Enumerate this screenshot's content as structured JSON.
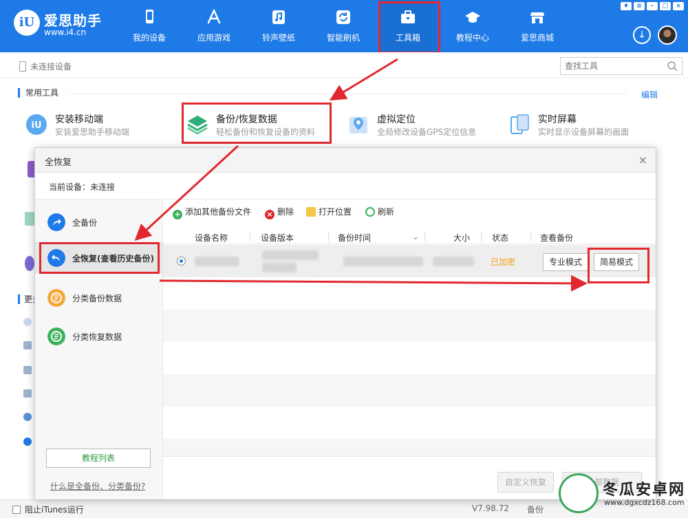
{
  "brand": {
    "logo_text": "iU",
    "name": "爱思助手",
    "url": "www.i4.cn"
  },
  "nav": [
    {
      "label": "我的设备",
      "icon": "phone-icon"
    },
    {
      "label": "应用游戏",
      "icon": "app-store-icon"
    },
    {
      "label": "铃声壁纸",
      "icon": "music-icon"
    },
    {
      "label": "智能刷机",
      "icon": "refresh-icon"
    },
    {
      "label": "工具箱",
      "icon": "toolbox-icon",
      "active": true
    },
    {
      "label": "教程中心",
      "icon": "graduation-cap-icon"
    },
    {
      "label": "爱思商城",
      "icon": "store-icon"
    }
  ],
  "device_bar": {
    "status": "未连接设备",
    "search_placeholder": "查找工具"
  },
  "common_tools": {
    "title": "常用工具",
    "edit": "编辑",
    "items": [
      {
        "name": "安装移动端",
        "desc": "安装爱思助手移动端",
        "icon": "i4-app-icon"
      },
      {
        "name": "备份/恢复数据",
        "desc": "轻松备份和恢复设备的资料",
        "icon": "layers-icon"
      },
      {
        "name": "虚拟定位",
        "desc": "全局修改设备GPS定位信息",
        "icon": "map-pin-icon"
      },
      {
        "name": "实时屏幕",
        "desc": "实时显示设备屏幕的画面",
        "icon": "screen-icon"
      }
    ]
  },
  "more_tools": {
    "title": "更多"
  },
  "dialog": {
    "title": "全恢复",
    "close": "×",
    "current_device": "当前设备：未连接",
    "sidebar": [
      {
        "label": "全备份",
        "icon": "share-arrow-icon",
        "color": "#1e7ae6"
      },
      {
        "label": "全恢复(查看历史备份)",
        "icon": "undo-arrow-icon",
        "color": "#1e7ae6",
        "active": true
      },
      {
        "label": "分类备份数据",
        "icon": "category-backup-icon",
        "color": "#f4a83a"
      },
      {
        "label": "分类恢复数据",
        "icon": "category-restore-icon",
        "color": "#3cb15a"
      }
    ],
    "tutorial_button": "教程列表",
    "faq_link": "什么是全备份、分类备份?",
    "toolbar": {
      "add": "添加其他备份文件",
      "delete": "删除",
      "open_location": "打开位置",
      "refresh": "刷新"
    },
    "columns": [
      "设备名称",
      "设备版本",
      "备份时间",
      "大小",
      "状态",
      "查看备份"
    ],
    "rows": [
      {
        "status": "已加密",
        "pro_mode": "专业模式",
        "easy_mode": "简易模式"
      }
    ],
    "footer": {
      "custom_restore": "自定义恢复",
      "restore_all": "恢复全部数据"
    }
  },
  "bottom": {
    "itunes": "阻止iTunes运行",
    "version": "V7.98.72",
    "backup": "备份"
  },
  "watermark": {
    "title": "冬瓜安卓网",
    "url": "www.dgxcdz168.com"
  },
  "window_controls": [
    "shirt-icon",
    "menu-icon",
    "minimize-icon",
    "maximize-icon",
    "close-icon"
  ],
  "colors": {
    "brand_blue": "#1e7ae6",
    "annotation_red": "#e0282e",
    "encrypted_orange": "#f39c12",
    "tutorial_green": "#2f9a3d"
  }
}
